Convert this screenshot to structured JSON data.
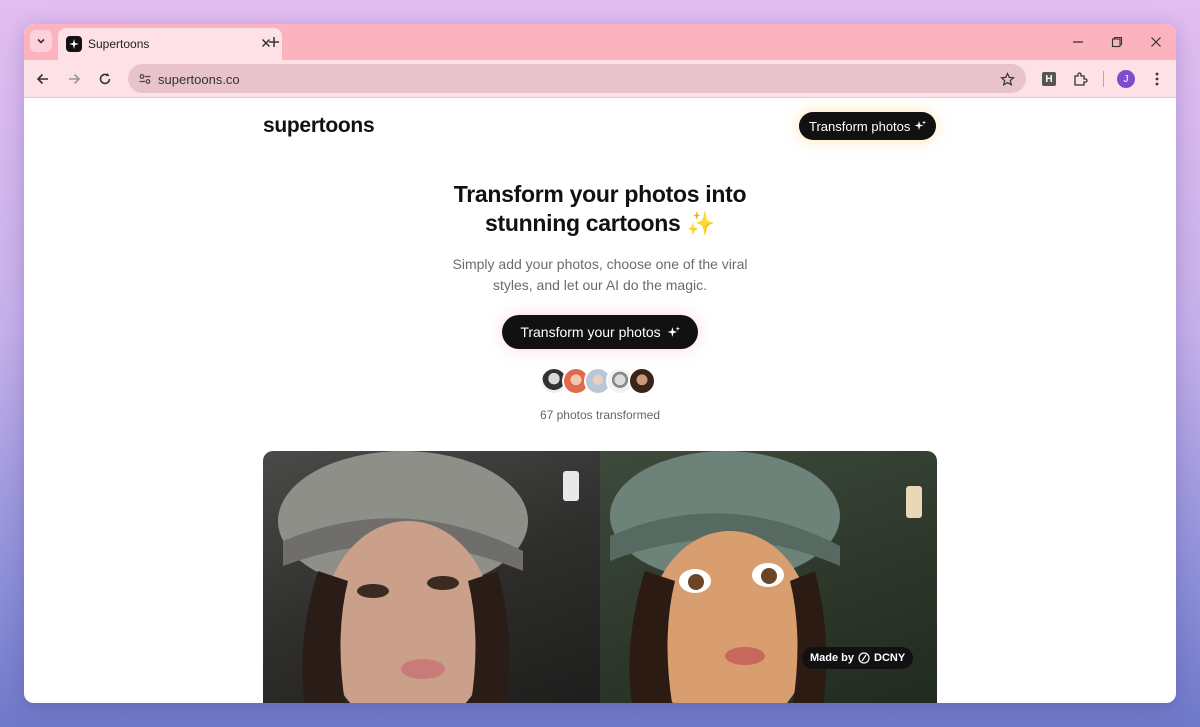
{
  "browser": {
    "tab_title": "Supertoons",
    "url": "supertoons.co",
    "profile_initial": "J",
    "extension_label": "H"
  },
  "site": {
    "logo": "supertoons",
    "nav_cta": "Transform photos",
    "hero_title_line1": "Transform your photos into",
    "hero_title_line2": "stunning cartoons ✨",
    "hero_sub_line1": "Simply add your photos, choose one of the viral",
    "hero_sub_line2": "styles, and let our AI do the magic.",
    "hero_cta": "Transform your photos",
    "count_text": "67 photos transformed",
    "badge_text": "Made by",
    "badge_brand": "DCNY"
  },
  "colors": {
    "tabstrip": "#fbb3c0",
    "toolbar": "#fde1e6",
    "cta": "#111111"
  }
}
